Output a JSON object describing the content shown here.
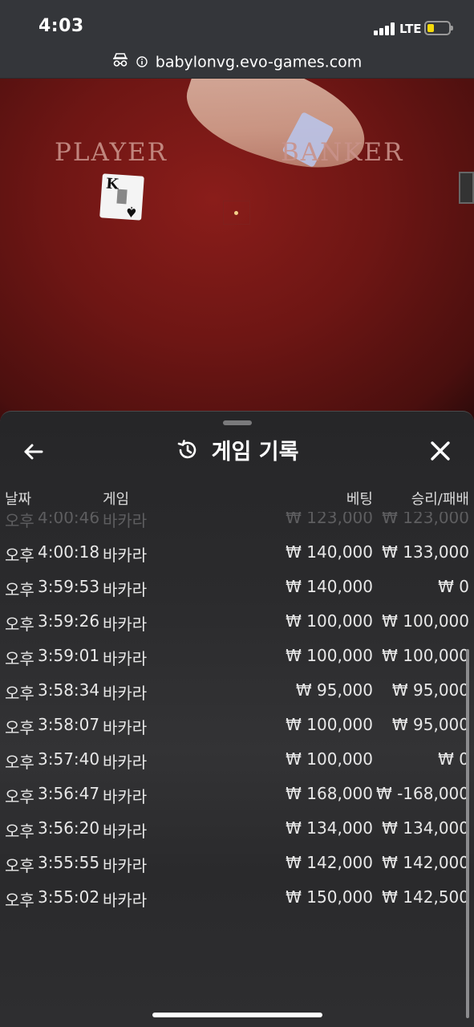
{
  "status_bar": {
    "time": "4:03",
    "network": "LTE",
    "battery_color": "#f5d90a"
  },
  "browser": {
    "url": "babylonvg.evo-games.com",
    "icons": [
      "incognito-icon",
      "info-icon"
    ]
  },
  "table": {
    "player_label": "PLAYER",
    "banker_label": "BANKER",
    "card_rank": "K",
    "card_suit": "♠"
  },
  "panel": {
    "title": "게임 기록",
    "icons": [
      "back-arrow-icon",
      "history-icon",
      "close-icon"
    ],
    "columns": {
      "date": "날짜",
      "game": "게임",
      "bet": "베팅",
      "result": "승리/패배"
    },
    "rows": [
      {
        "ampm": "오후",
        "time": "4:00:46",
        "game": "바카라",
        "bet": "₩ 123,000",
        "result": "₩ 123,000"
      },
      {
        "ampm": "오후",
        "time": "4:00:18",
        "game": "바카라",
        "bet": "₩ 140,000",
        "result": "₩ 133,000"
      },
      {
        "ampm": "오후",
        "time": "3:59:53",
        "game": "바카라",
        "bet": "₩ 140,000",
        "result": "₩ 0"
      },
      {
        "ampm": "오후",
        "time": "3:59:26",
        "game": "바카라",
        "bet": "₩ 100,000",
        "result": "₩ 100,000"
      },
      {
        "ampm": "오후",
        "time": "3:59:01",
        "game": "바카라",
        "bet": "₩ 100,000",
        "result": "₩ 100,000"
      },
      {
        "ampm": "오후",
        "time": "3:58:34",
        "game": "바카라",
        "bet": "₩ 95,000",
        "result": "₩ 95,000"
      },
      {
        "ampm": "오후",
        "time": "3:58:07",
        "game": "바카라",
        "bet": "₩ 100,000",
        "result": "₩ 95,000"
      },
      {
        "ampm": "오후",
        "time": "3:57:40",
        "game": "바카라",
        "bet": "₩ 100,000",
        "result": "₩ 0"
      },
      {
        "ampm": "오후",
        "time": "3:56:47",
        "game": "바카라",
        "bet": "₩ 168,000",
        "result": "₩ -168,000"
      },
      {
        "ampm": "오후",
        "time": "3:56:20",
        "game": "바카라",
        "bet": "₩ 134,000",
        "result": "₩ 134,000"
      },
      {
        "ampm": "오후",
        "time": "3:55:55",
        "game": "바카라",
        "bet": "₩ 142,000",
        "result": "₩ 142,000"
      },
      {
        "ampm": "오후",
        "time": "3:55:02",
        "game": "바카라",
        "bet": "₩ 150,000",
        "result": "₩ 142,500"
      }
    ]
  }
}
